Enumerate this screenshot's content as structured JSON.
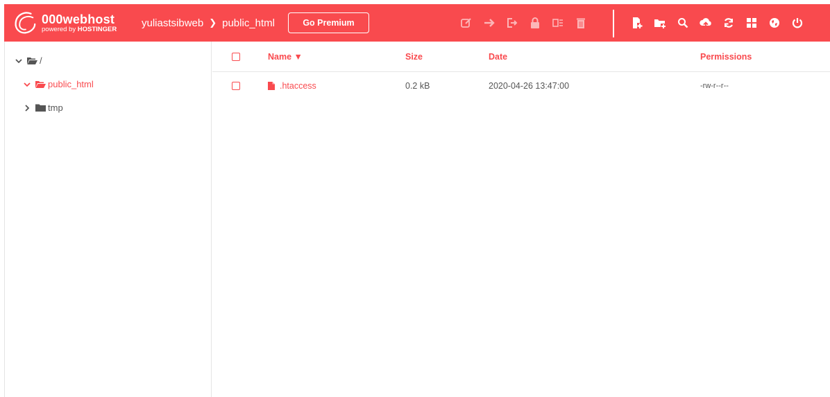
{
  "colors": {
    "brand": "#f94a4e",
    "text": "#555555",
    "white": "#ffffff"
  },
  "header": {
    "logo": {
      "name": "000webhost",
      "sub_prefix": "powered by ",
      "sub_brand": "HOSTINGER"
    },
    "breadcrumb": {
      "site": "yuliastsibweb",
      "folder": "public_html"
    },
    "premium_label": "Go Premium",
    "tools_disabled": [
      "edit-icon",
      "move-icon",
      "rename-icon",
      "lock-icon",
      "extract-icon",
      "trash-icon"
    ],
    "tools": [
      "new-file-icon",
      "new-folder-icon",
      "search-icon",
      "upload-icon",
      "refresh-icon",
      "grid-view-icon",
      "globe-icon",
      "power-icon"
    ]
  },
  "sidebar": {
    "root": {
      "label": "/"
    },
    "items": [
      {
        "label": "public_html",
        "expanded": true,
        "active": true
      },
      {
        "label": "tmp",
        "expanded": false,
        "active": false
      }
    ]
  },
  "table": {
    "columns": {
      "name": "Name ▼",
      "size": "Size",
      "date": "Date",
      "permissions": "Permissions"
    },
    "rows": [
      {
        "name": ".htaccess",
        "size": "0.2 kB",
        "date": "2020-04-26 13:47:00",
        "permissions": "-rw-r--r--"
      }
    ]
  }
}
